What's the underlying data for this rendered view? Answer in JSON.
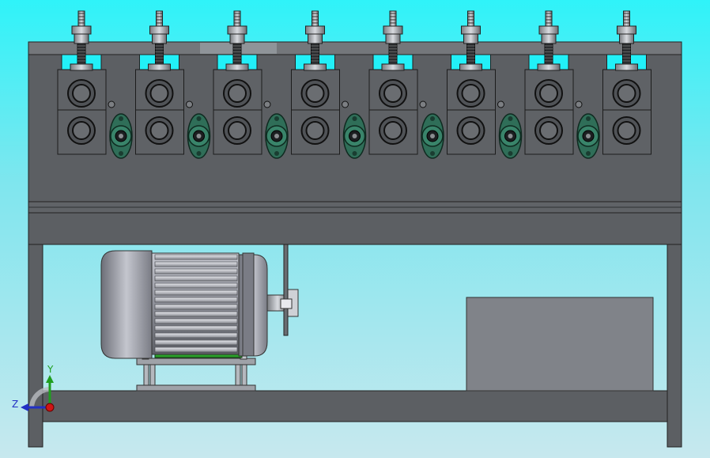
{
  "app": {
    "title": "",
    "view": "front"
  },
  "colors": {
    "background_top": "#2ff3f9",
    "background_bottom": "#c7e8ee",
    "frame": "#5e6164",
    "frame_dark": "#3d4043",
    "block": "#5c5f63",
    "bearing": "#2f6e58",
    "motor": "#8d8f95",
    "motor_base_green": "#2aa02a",
    "box": "#808389"
  },
  "model": {
    "roller_stations": 8,
    "flange_bearings": 7
  },
  "triad": {
    "x_label": "",
    "y_label": "Y",
    "z_label": "Z"
  }
}
